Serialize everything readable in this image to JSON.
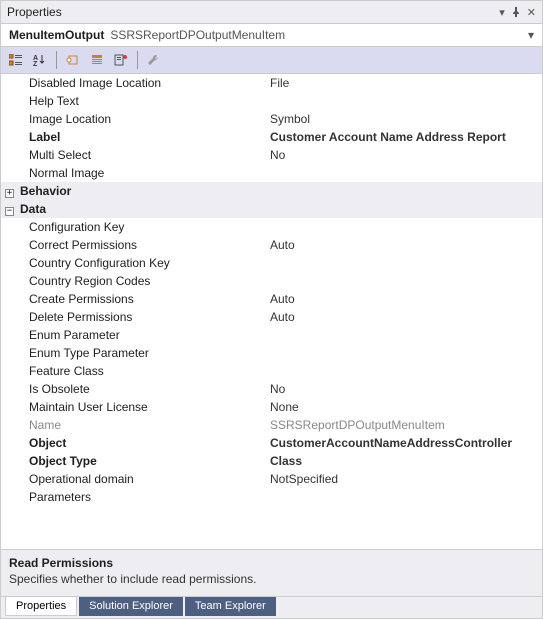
{
  "window": {
    "title": "Properties"
  },
  "object": {
    "primary": "MenuItemOutput",
    "secondary": "SSRSReportDPOutputMenuItem"
  },
  "categories": {
    "behavior": "Behavior",
    "data": "Data"
  },
  "props": {
    "disabledImageLocation": {
      "name": "Disabled Image Location",
      "value": "File"
    },
    "helpText": {
      "name": "Help Text",
      "value": ""
    },
    "imageLocation": {
      "name": "Image Location",
      "value": "Symbol"
    },
    "label": {
      "name": "Label",
      "value": "Customer Account Name Address Report"
    },
    "multiSelect": {
      "name": "Multi Select",
      "value": "No"
    },
    "normalImage": {
      "name": "Normal Image",
      "value": ""
    },
    "configurationKey": {
      "name": "Configuration Key",
      "value": ""
    },
    "correctPermissions": {
      "name": "Correct Permissions",
      "value": "Auto"
    },
    "countryConfigurationKey": {
      "name": "Country Configuration Key",
      "value": ""
    },
    "countryRegionCodes": {
      "name": "Country Region Codes",
      "value": ""
    },
    "createPermissions": {
      "name": "Create Permissions",
      "value": "Auto"
    },
    "deletePermissions": {
      "name": "Delete Permissions",
      "value": "Auto"
    },
    "enumParameter": {
      "name": "Enum Parameter",
      "value": ""
    },
    "enumTypeParameter": {
      "name": "Enum Type Parameter",
      "value": ""
    },
    "featureClass": {
      "name": "Feature Class",
      "value": ""
    },
    "isObsolete": {
      "name": "Is Obsolete",
      "value": "No"
    },
    "maintainUserLicense": {
      "name": "Maintain User License",
      "value": "None"
    },
    "nameProp": {
      "name": "Name",
      "value": "SSRSReportDPOutputMenuItem"
    },
    "object": {
      "name": "Object",
      "value": "CustomerAccountNameAddressController"
    },
    "objectType": {
      "name": "Object Type",
      "value": "Class"
    },
    "operationalDomain": {
      "name": "Operational domain",
      "value": "NotSpecified"
    },
    "parameters": {
      "name": "Parameters",
      "value": ""
    }
  },
  "description": {
    "title": "Read Permissions",
    "text": "Specifies whether to include read permissions."
  },
  "tabs": {
    "properties": "Properties",
    "solution": "Solution Explorer",
    "team": "Team Explorer"
  }
}
